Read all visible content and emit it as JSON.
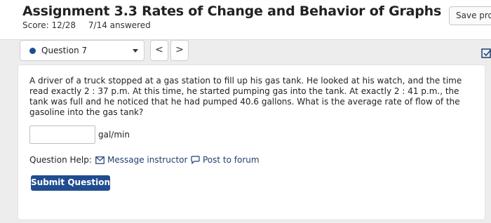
{
  "assignment": {
    "title": "Assignment 3.3 Rates of Change and Behavior of Graphs",
    "score": "Score: 12/28",
    "answered": "7/14 answered",
    "save_label": "Save progress"
  },
  "question_nav": {
    "selected": "Question 7",
    "prev_label": "<",
    "next_label": ">"
  },
  "question": {
    "text": "A driver of a truck stopped at a gas station to fill up his gas tank. He looked at his watch, and the time read exactly 2 : 37 p.m. At this time, he started pumping gas into the tank. At exactly 2 : 41 p.m., the tank was full and he noticed that he had pumped 40.6 gallons. What is the average rate of flow of the gasoline into the gas tank?",
    "answer_value": "",
    "unit": "gal/min"
  },
  "help": {
    "label": "Question Help:",
    "message_link": "Message instructor",
    "forum_link": "Post to forum"
  },
  "submit_label": "Submit Question",
  "colors": {
    "accent": "#1f4d8f",
    "background": "#ededed"
  }
}
